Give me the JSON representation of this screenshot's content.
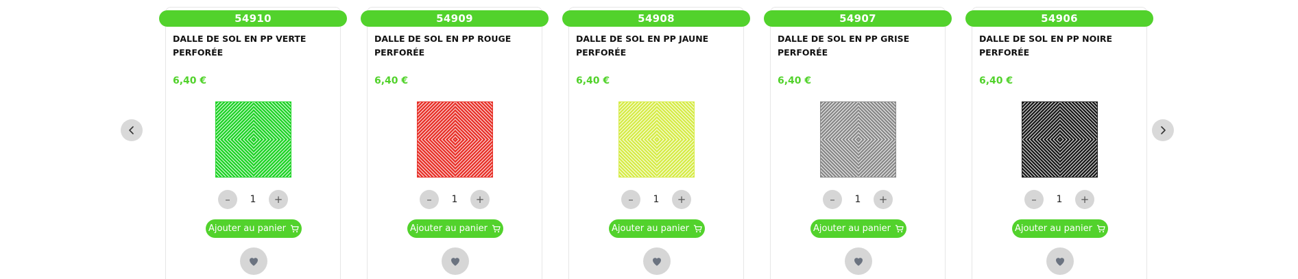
{
  "navigation": {
    "prev_icon": "chevron-left-icon",
    "next_icon": "chevron-right-icon"
  },
  "colors": {
    "accent": "#52d22c",
    "button_grey": "#d6d6d6",
    "heart": "#6b7380"
  },
  "products": [
    {
      "ref": "54910",
      "title": "DALLE DE SOL EN PP VERTE PERFORÉE",
      "price": "6,40 €",
      "tile_color": "#22d42a",
      "quantity": "1",
      "minus": "–",
      "plus": "+",
      "add_to_cart": "Ajouter au panier",
      "cart_icon": "cart-icon",
      "fav_icon": "heart-icon"
    },
    {
      "ref": "54909",
      "title": "DALLE DE SOL EN PP ROUGE PERFORÉE",
      "price": "6,40 €",
      "tile_color": "#e8342c",
      "quantity": "1",
      "minus": "–",
      "plus": "+",
      "add_to_cart": "Ajouter au panier",
      "cart_icon": "cart-icon",
      "fav_icon": "heart-icon"
    },
    {
      "ref": "54908",
      "title": "DALLE DE SOL EN PP JAUNE PERFORÉE",
      "price": "6,40 €",
      "tile_color": "#d7ec4a",
      "quantity": "1",
      "minus": "–",
      "plus": "+",
      "add_to_cart": "Ajouter au panier",
      "cart_icon": "cart-icon",
      "fav_icon": "heart-icon"
    },
    {
      "ref": "54907",
      "title": "DALLE DE SOL EN PP GRISE PERFORÉE",
      "price": "6,40 €",
      "tile_color": "#8a8a8a",
      "quantity": "1",
      "minus": "–",
      "plus": "+",
      "add_to_cart": "Ajouter au panier",
      "cart_icon": "cart-icon",
      "fav_icon": "heart-icon"
    },
    {
      "ref": "54906",
      "title": "DALLE DE SOL EN PP NOIRE PERFORÉE",
      "price": "6,40 €",
      "tile_color": "#1e1e1e",
      "quantity": "1",
      "minus": "–",
      "plus": "+",
      "add_to_cart": "Ajouter au panier",
      "cart_icon": "cart-icon",
      "fav_icon": "heart-icon"
    }
  ]
}
